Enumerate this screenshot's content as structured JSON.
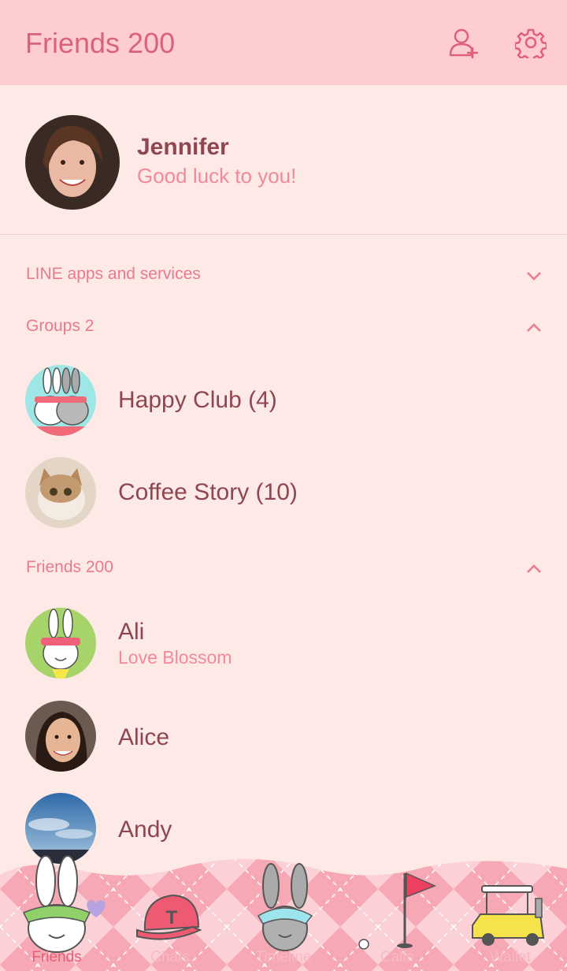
{
  "header": {
    "title": "Friends 200"
  },
  "profile": {
    "name": "Jennifer",
    "status": "Good luck to you!"
  },
  "sections": {
    "apps": "LINE apps and services",
    "groups": "Groups 2",
    "friends": "Friends 200"
  },
  "groups": [
    {
      "name": "Happy Club (4)"
    },
    {
      "name": "Coffee Story (10)"
    }
  ],
  "friends": [
    {
      "name": "Ali",
      "status": "Love Blossom"
    },
    {
      "name": "Alice"
    },
    {
      "name": "Andy"
    }
  ],
  "tabs": [
    {
      "label": "Friends"
    },
    {
      "label": "Chats"
    },
    {
      "label": "Timeline"
    },
    {
      "label": "Calls"
    },
    {
      "label": "Wallet"
    }
  ],
  "colors": {
    "accent": "#e55f77",
    "header_bg": "#fdcdd2",
    "body_bg": "#fde9e6",
    "name_text": "#8e4652"
  }
}
